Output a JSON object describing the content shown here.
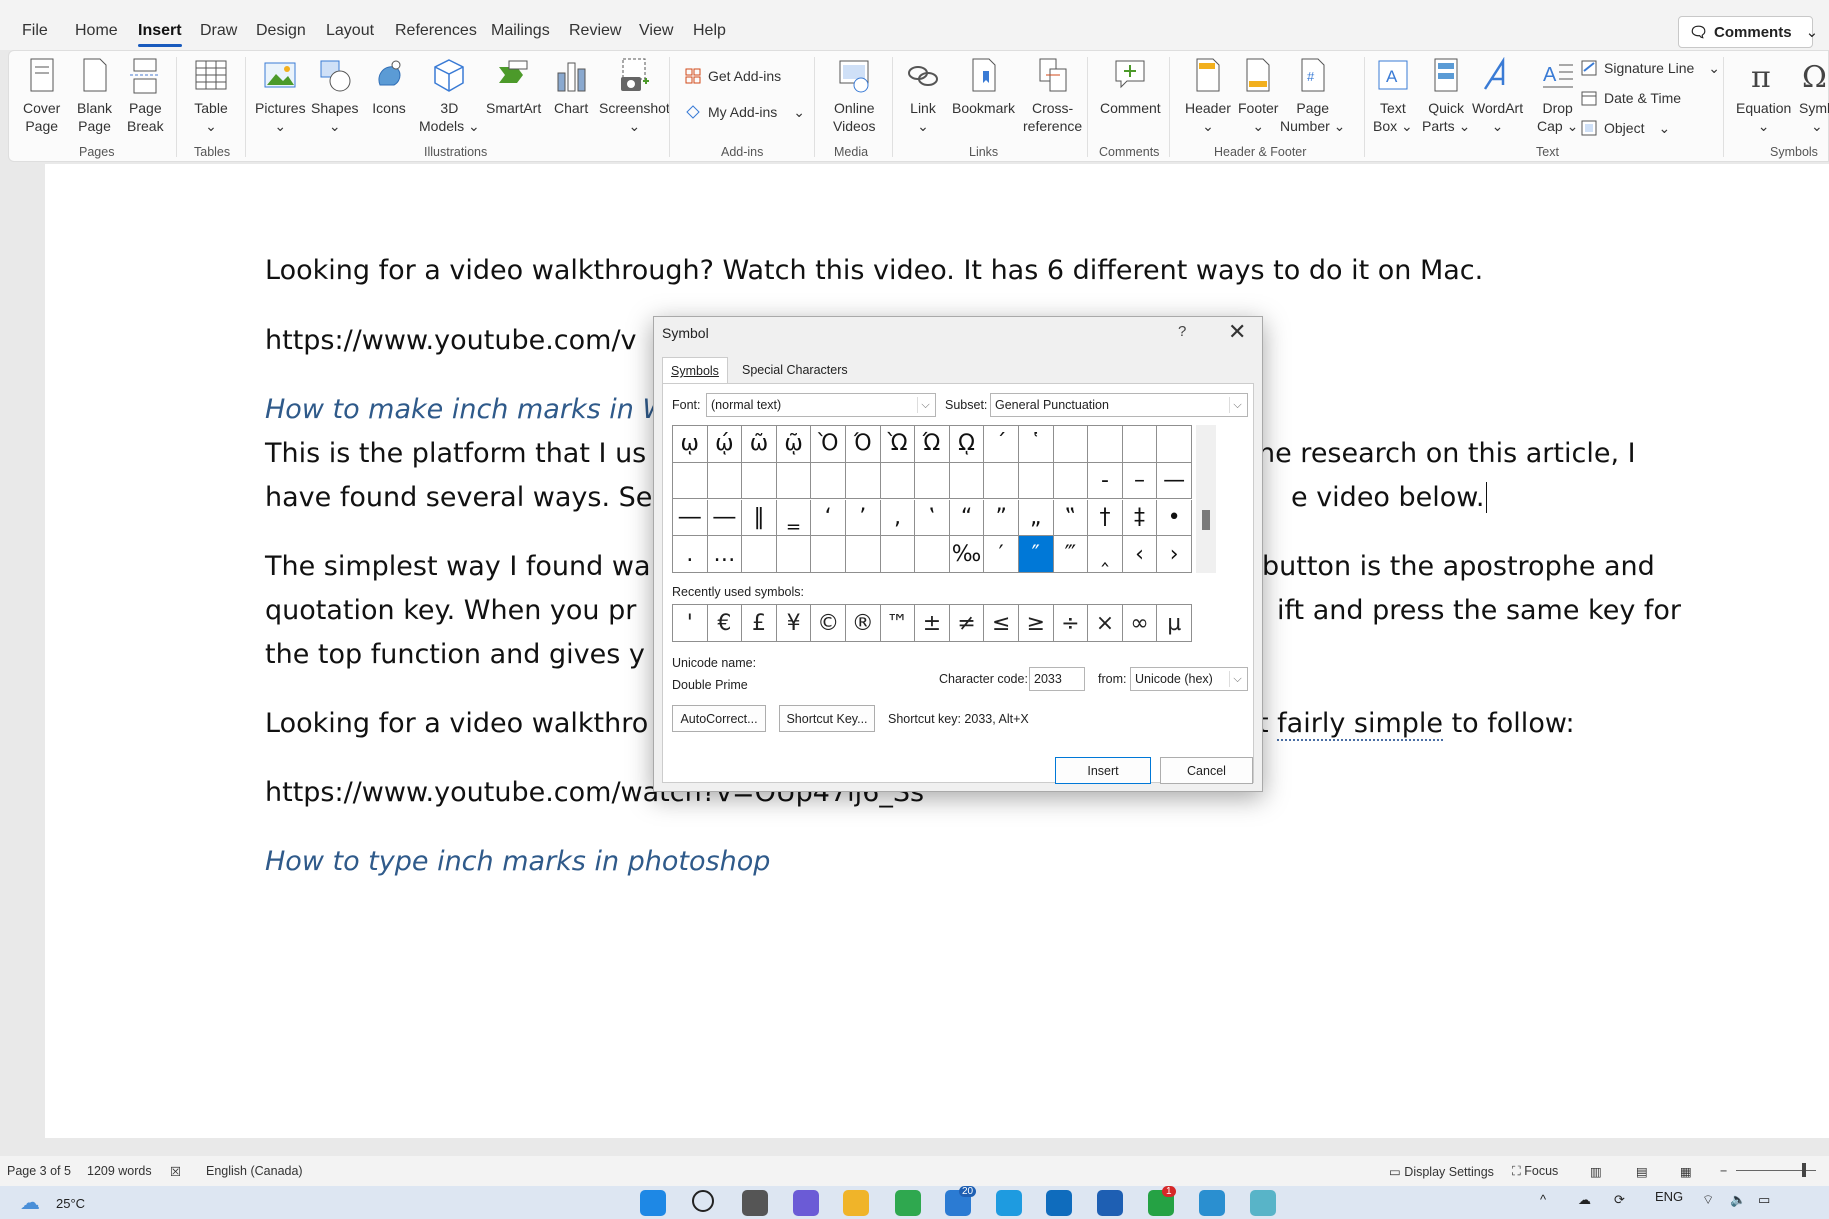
{
  "menu": {
    "tabs": [
      "File",
      "Home",
      "Insert",
      "Draw",
      "Design",
      "Layout",
      "References",
      "Mailings",
      "Review",
      "View",
      "Help"
    ],
    "active_tab": "Insert",
    "comments_label": "Comments"
  },
  "ribbon": {
    "cover_page": [
      "Cover",
      "Page"
    ],
    "blank_page": [
      "Blank",
      "Page"
    ],
    "page_break": [
      "Page",
      "Break"
    ],
    "table": "Table",
    "pictures": "Pictures",
    "shapes": "Shapes",
    "icons": "Icons",
    "models_3d": [
      "3D",
      "Models"
    ],
    "smartart": "SmartArt",
    "chart": "Chart",
    "screenshot": "Screenshot",
    "get_addins": "Get Add-ins",
    "my_addins": "My Add-ins",
    "online_videos": [
      "Online",
      "Videos"
    ],
    "link": "Link",
    "bookmark": "Bookmark",
    "cross_reference": [
      "Cross-",
      "reference"
    ],
    "comment": "Comment",
    "header": "Header",
    "footer": "Footer",
    "page_number": [
      "Page",
      "Number"
    ],
    "text_box": [
      "Text",
      "Box"
    ],
    "quick_parts": [
      "Quick",
      "Parts"
    ],
    "wordart": "WordArt",
    "drop_cap": [
      "Drop",
      "Cap"
    ],
    "signature_line": "Signature Line",
    "date_time": "Date & Time",
    "object": "Object",
    "equation": "Equation",
    "symbol": "Symb",
    "groups": {
      "pages": "Pages",
      "tables": "Tables",
      "illustrations": "Illustrations",
      "addins": "Add-ins",
      "media": "Media",
      "links": "Links",
      "comments": "Comments",
      "header_footer": "Header & Footer",
      "text": "Text",
      "symbols": "Symbols"
    }
  },
  "document": {
    "p1": "Looking for a video walkthrough? Watch this video. It has 6 different ways to do it on Mac.",
    "p2": "https://www.youtube.com/v",
    "h1": "How to make inch marks in W",
    "p3a_left": "This is the platform that I us",
    "p3a_right": "he research on this article, I",
    "p3b_left": "have found several ways. Se",
    "p3b_right": "e video below.",
    "p4a_left": "The simplest way I found wa",
    "p4a_right": "button is the apostrophe and",
    "p4b_left": "quotation key. When you pr",
    "p4b_right": "ift and press the same key for",
    "p4c_left": "the top function and gives y",
    "p5_left": "Looking for a video walkthro",
    "p5_mid": "t ",
    "p5_link": "fairly simple",
    "p5_end": " to follow:",
    "p6": "https://www.youtube.com/watch?v=OUp47lj6_Ss",
    "h2": "How to type inch marks in photoshop"
  },
  "dialog": {
    "title": "Symbol",
    "help": "?",
    "close": "✕",
    "tab_symbols": "Symbols",
    "tab_special": "Special Characters",
    "font_label": "Font:",
    "font_value": "(normal text)",
    "subset_label": "Subset:",
    "subset_value": "General Punctuation",
    "grid_rows": [
      [
        "ῳ",
        "ῴ",
        "ῶ",
        "ῷ",
        "Ὸ",
        "Ό",
        "Ὼ",
        "Ώ",
        "ῼ",
        "´",
        "῾",
        "",
        "",
        "",
        ""
      ],
      [
        "",
        "",
        "",
        "",
        "",
        "",
        "",
        "",
        "",
        "",
        "",
        "",
        "‐",
        "–",
        "—"
      ],
      [
        "―",
        "―",
        "‖",
        "‗",
        "‘",
        "’",
        "‚",
        "‛",
        "“",
        "”",
        "„",
        "‟",
        "†",
        "‡",
        "•"
      ],
      [
        "․",
        "…",
        "",
        "",
        "",
        "",
        "",
        "",
        "‰",
        "′",
        "″",
        "‴",
        "‸",
        "‹",
        "›"
      ]
    ],
    "selected_cell": "3-10",
    "recent_label": "Recently used symbols:",
    "recent": [
      "'",
      "€",
      "£",
      "¥",
      "©",
      "®",
      "™",
      "±",
      "≠",
      "≤",
      "≥",
      "÷",
      "×",
      "∞",
      "µ"
    ],
    "unicode_name_label": "Unicode name:",
    "unicode_name": "Double Prime",
    "char_code_label": "Character code:",
    "char_code": "2033",
    "from_label": "from:",
    "from_value": "Unicode (hex)",
    "autocorrect": "AutoCorrect...",
    "shortcut_key_btn": "Shortcut Key...",
    "shortcut_key_text": "Shortcut key: 2033, Alt+X",
    "insert": "Insert",
    "cancel": "Cancel"
  },
  "status": {
    "page": "Page 3 of 5",
    "words": "1209 words",
    "language": "English (Canada)",
    "display_settings": "Display Settings",
    "focus": "Focus"
  },
  "taskbar": {
    "temp": "25°C",
    "lang": "ENG",
    "badge_store": "20",
    "badge_whatsapp": "1"
  }
}
